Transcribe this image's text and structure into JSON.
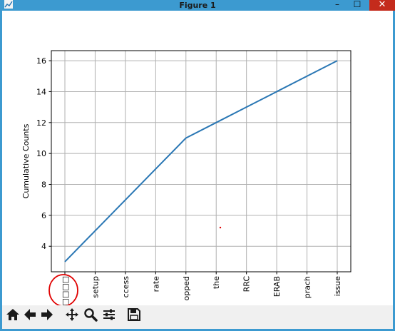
{
  "window": {
    "title": "Figure 1",
    "min_glyph": "–",
    "max_glyph": "☐",
    "close_glyph": "✕"
  },
  "chart_data": {
    "type": "line",
    "title": "",
    "xlabel": "",
    "ylabel": "Cumulative Counts",
    "categories": [
      "□□□□",
      "setup",
      "ccess",
      "rate",
      "opped",
      "the",
      "RRC",
      "ERAB",
      "prach",
      "issue"
    ],
    "series": [
      {
        "values": [
          3,
          5,
          7,
          9,
          11,
          12,
          13,
          14,
          15,
          16
        ]
      }
    ],
    "yticks": [
      4,
      6,
      8,
      10,
      12,
      14,
      16
    ],
    "ylim": [
      2.35,
      16.65
    ],
    "grid": true,
    "line_color": "#2a77b4"
  },
  "toolbar": {
    "icons": [
      "home-icon",
      "back-arrow-icon",
      "forward-arrow-icon",
      "pan-icon",
      "zoom-icon",
      "configure-subplots-icon",
      "save-icon"
    ]
  },
  "colors": {
    "titlebar": "#3c9ad0",
    "close": "#c42b1c",
    "annotation": "#e00000"
  }
}
